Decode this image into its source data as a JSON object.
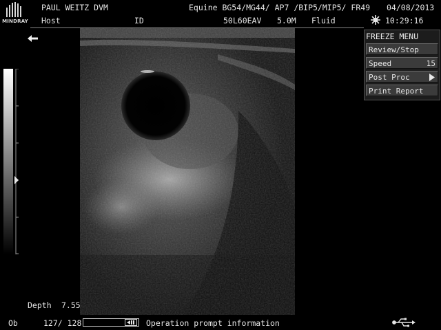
{
  "brand": {
    "logo_text": "MINDRAY",
    "icon": "mindray-logo-icon"
  },
  "header": {
    "operator": "PAUL WEITZ DVM",
    "preset": "Equine BG54/MG44/ AP7 /BIP5/MIP5/ FR49",
    "date": "04/08/2013",
    "host_label": "Host",
    "id_label": "ID",
    "probe": "50L60EAV",
    "frequency": "5.0M",
    "exam": "Fluid",
    "time": "10:29:16",
    "freeze_icon": "snowflake-icon"
  },
  "side": {
    "back_icon": "arrow-left-icon",
    "depth_label": "Depth",
    "depth_value": "7.55"
  },
  "menu": {
    "title": "FREEZE MENU",
    "items": [
      {
        "label": "Review/Stop",
        "value": ""
      },
      {
        "label": "Speed",
        "value": "15"
      },
      {
        "label": "Post Proc",
        "value": ""
      },
      {
        "label": "Print Report",
        "value": ""
      }
    ],
    "post_proc_icon": "triangle-right-icon"
  },
  "footer": {
    "mode": "Ob",
    "frame": "127/ 128",
    "prompt": "Operation prompt information",
    "cine_icon": "cine-icon",
    "usb_icon": "usb-icon"
  },
  "colors": {
    "background": "#000000",
    "text": "#e6e6e6",
    "menu_bg": "#3b3b3b"
  }
}
